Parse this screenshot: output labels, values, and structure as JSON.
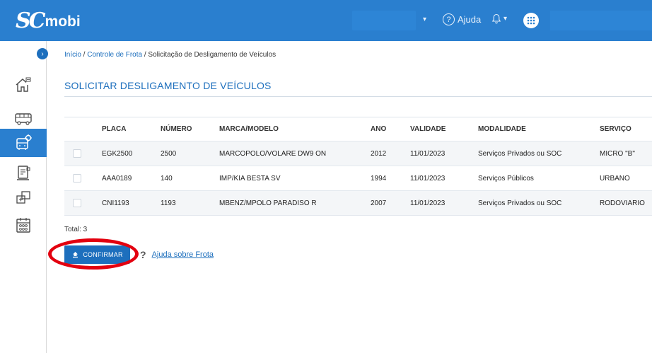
{
  "header": {
    "logo_sc": "SC",
    "logo_mobi": "mobi",
    "help_label": "Ajuda",
    "help_icon": "?",
    "dropdown_icon": "▾",
    "bell_caret": "▾"
  },
  "sidebar": {
    "toggle_icon": "›",
    "items": [
      {
        "icon": "home-icon"
      },
      {
        "icon": "bus-icon"
      },
      {
        "icon": "fleet-settings-icon"
      },
      {
        "icon": "document-icon"
      },
      {
        "icon": "transfer-icon"
      },
      {
        "icon": "calendar-icon"
      }
    ]
  },
  "breadcrumb": {
    "home": "Início",
    "sep1": " / ",
    "section": "Controle de Frota",
    "sep2": " / ",
    "current": "Solicitação de Desligamento de Veículos"
  },
  "page_title": "SOLICITAR DESLIGAMENTO DE VEÍCULOS",
  "table": {
    "headers": {
      "placa": "PLACA",
      "numero": "NÚMERO",
      "marca": "MARCA/MODELO",
      "ano": "ANO",
      "validade": "VALIDADE",
      "modalidade": "MODALIDADE",
      "servico": "SERVIÇO"
    },
    "rows": [
      {
        "placa": "EGK2500",
        "numero": "2500",
        "marca": "MARCOPOLO/VOLARE DW9 ON",
        "ano": "2012",
        "validade": "11/01/2023",
        "modalidade": "Serviços Privados ou SOC",
        "servico": "MICRO \"B\""
      },
      {
        "placa": "AAA0189",
        "numero": "140",
        "marca": "IMP/KIA BESTA SV",
        "ano": "1994",
        "validade": "11/01/2023",
        "modalidade": "Serviços Públicos",
        "servico": "URBANO"
      },
      {
        "placa": "CNI1193",
        "numero": "1193",
        "marca": "MBENZ/MPOLO PARADISO R",
        "ano": "2007",
        "validade": "11/01/2023",
        "modalidade": "Serviços Privados ou SOC",
        "servico": "RODOVIARIO"
      }
    ]
  },
  "total_label": "Total: 3",
  "confirm_label": "CONFIRMAR",
  "help_link": {
    "icon": "?",
    "label": "Ajuda sobre Frota"
  },
  "colors": {
    "primary": "#2a7fcf",
    "accent": "#1d6fbd",
    "annotation": "#e3000f"
  }
}
